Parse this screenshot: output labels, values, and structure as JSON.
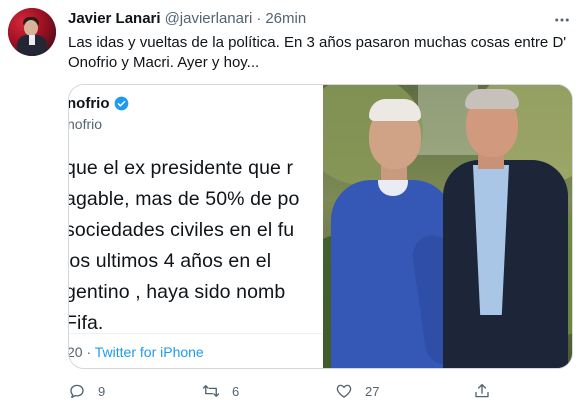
{
  "tweet": {
    "author": {
      "name": "Javier Lanari",
      "handle": "@javierlanari",
      "time": "26min",
      "separator": "·"
    },
    "text": "Las idas y vueltas de la política. En 3 años pasaron muchas cosas entre D' Onofrio y Macri. Ayer y hoy...",
    "media": {
      "left_screenshot": {
        "name_fragment": "nofrio",
        "handle_fragment": "nofrio",
        "lines": [
          "que el ex presidente que r",
          "agable, mas de 50% de po",
          "sociedades civiles en el fu",
          " los ultimos 4 años  en el",
          "gentino , haya sido nomb",
          "Fifa."
        ],
        "footer_time": "20",
        "footer_separator": " · ",
        "footer_source": "Twitter for iPhone"
      },
      "right_photo": {
        "icon": "photo"
      }
    },
    "actions": {
      "reply": {
        "icon": "reply-icon",
        "count": "9"
      },
      "retweet": {
        "icon": "retweet-icon",
        "count": "6"
      },
      "like": {
        "icon": "like-icon",
        "count": "27"
      },
      "share": {
        "icon": "share-icon"
      }
    },
    "more_icon": "more-icon"
  },
  "colors": {
    "text": "#0f1419",
    "secondary": "#536471",
    "accent": "#1d9bf0",
    "border": "#cfd9de"
  }
}
